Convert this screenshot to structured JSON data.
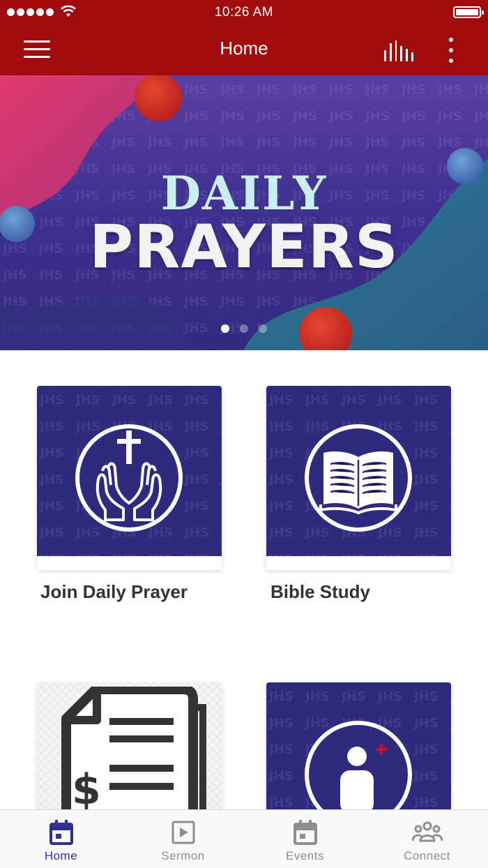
{
  "status_bar": {
    "time": "10:26 AM"
  },
  "header": {
    "title": "Home"
  },
  "banner": {
    "title_line1": "DAILY",
    "title_line2": "PRAYERS",
    "slides_total": 3,
    "active_slide": 1
  },
  "cards": [
    {
      "label": "Join Daily Prayer",
      "icon": "praying-hands-cross-icon"
    },
    {
      "label": "Bible Study",
      "icon": "open-bible-icon"
    },
    {
      "label": "",
      "icon": "document-dollar-icon"
    },
    {
      "label": "",
      "icon": "add-person-icon"
    }
  ],
  "tabs": [
    {
      "label": "Home",
      "icon": "calendar-icon",
      "active": true
    },
    {
      "label": "Sermon",
      "icon": "play-icon",
      "active": false
    },
    {
      "label": "Events",
      "icon": "calendar-icon",
      "active": false
    },
    {
      "label": "Connect",
      "icon": "group-icon",
      "active": false
    }
  ],
  "colors": {
    "header": "#a10b0e",
    "card_purple": "#2e2a7e",
    "tab_active": "#2e3192",
    "tab_inactive": "#8e8e8e"
  }
}
